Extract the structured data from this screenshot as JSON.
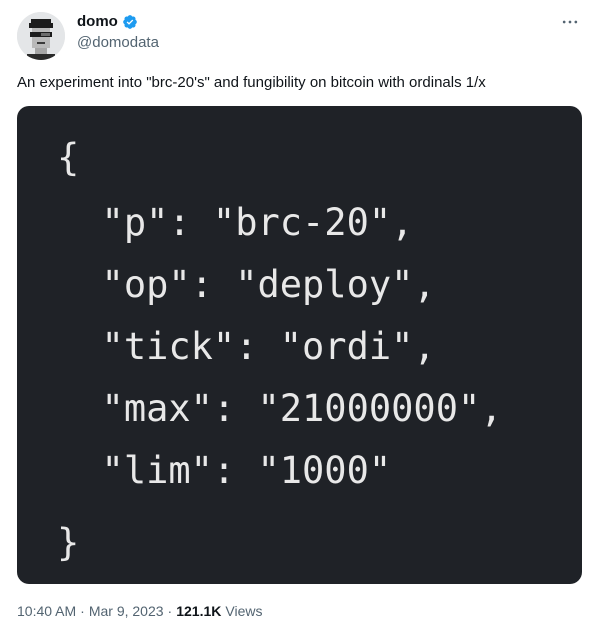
{
  "author": {
    "display_name": "domo",
    "handle": "@domodata",
    "avatar_icon": "pixel-punk-avatar",
    "verified": true
  },
  "more_icon": "ellipsis-icon",
  "tweet_text": "An experiment into \"brc-20's\" and fungibility on bitcoin with ordinals 1/x",
  "media": {
    "background": "#1f2227",
    "code_lines": [
      "{",
      "  \"p\": \"brc-20\",",
      "  \"op\": \"deploy\",",
      "  \"tick\": \"ordi\",",
      "  \"max\": \"21000000\",",
      "  \"lim\": \"1000\"",
      "}"
    ]
  },
  "meta": {
    "time": "10:40 AM",
    "separator": "·",
    "date": "Mar 9, 2023",
    "views_count": "121.1K",
    "views_label": "Views"
  },
  "colors": {
    "verified_blue": "#1d9bf0",
    "secondary_text": "#536471",
    "primary_text": "#0f1419"
  }
}
